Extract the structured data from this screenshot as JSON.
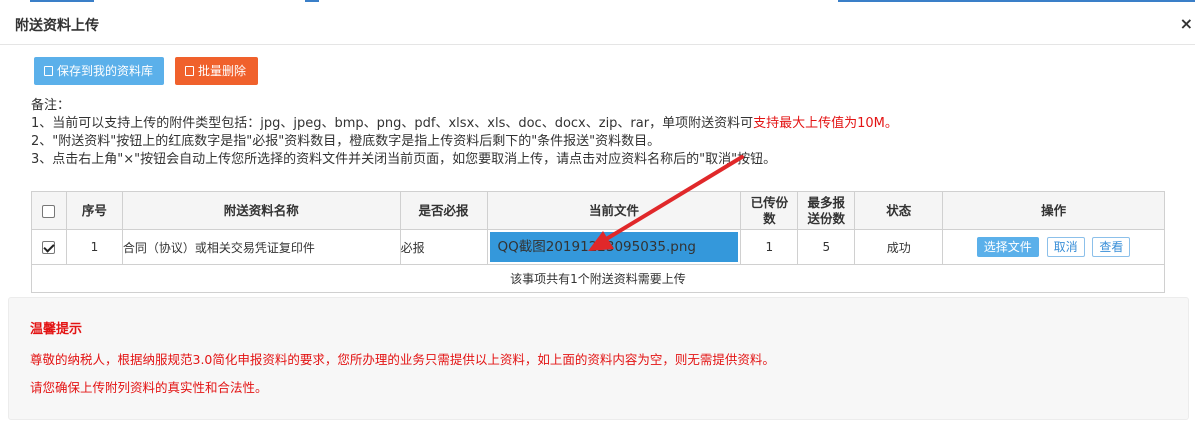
{
  "dialog": {
    "title": "附送资料上传"
  },
  "toolbar": {
    "save_label": "保存到我的资料库",
    "delete_label": "批量删除"
  },
  "notes": {
    "heading": "备注：",
    "line1": "1、当前可以支持上传的附件类型包括：jpg、jpeg、bmp、png、pdf、xlsx、xls、doc、docx、zip、rar，单项附送资料可",
    "line1_red": "支持最大上传值为10M。",
    "line2": "2、\"附送资料\"按钮上的红底数字是指\"必报\"资料数目，橙底数字是指上传资料后剩下的\"条件报送\"资料数目。",
    "line3": "3、点击右上角\"×\"按钮会自动上传您所选择的资料文件并关闭当前页面，如您要取消上传，请点击对应资料名称后的\"取消\"按钮。"
  },
  "table": {
    "headers": {
      "seq": "序号",
      "name": "附送资料名称",
      "required": "是否必报",
      "file": "当前文件",
      "uploaded_1": "已传份",
      "uploaded_2": "数",
      "max_1": "最多报",
      "max_2": "送份数",
      "status": "状态",
      "ops": "操作"
    },
    "rows": [
      {
        "seq": "1",
        "name": "合同（协议）或相关交易凭证复印件",
        "required": "必报",
        "file": "QQ截图20191223095035.png",
        "uploaded": "1",
        "max": "5",
        "status": "成功",
        "op_choose": "选择文件",
        "op_cancel": "取消",
        "op_view": "查看"
      }
    ],
    "footer": "该事项共有1个附送资料需要上传"
  },
  "tips": {
    "title": "温馨提示",
    "line1": "尊敬的纳税人，根据纳服规范3.0简化申报资料的要求，您所办理的业务只需提供以上资料，如上面的资料内容为空，则无需提供资料。",
    "line2": "请您确保上传附列资料的真实性和合法性。"
  },
  "colors": {
    "accent_blue": "#5bb0ea",
    "danger_orange": "#f0612c",
    "warning_red": "#e31414",
    "file_highlight": "#3498db",
    "annotation_arrow": "#e0282a"
  }
}
